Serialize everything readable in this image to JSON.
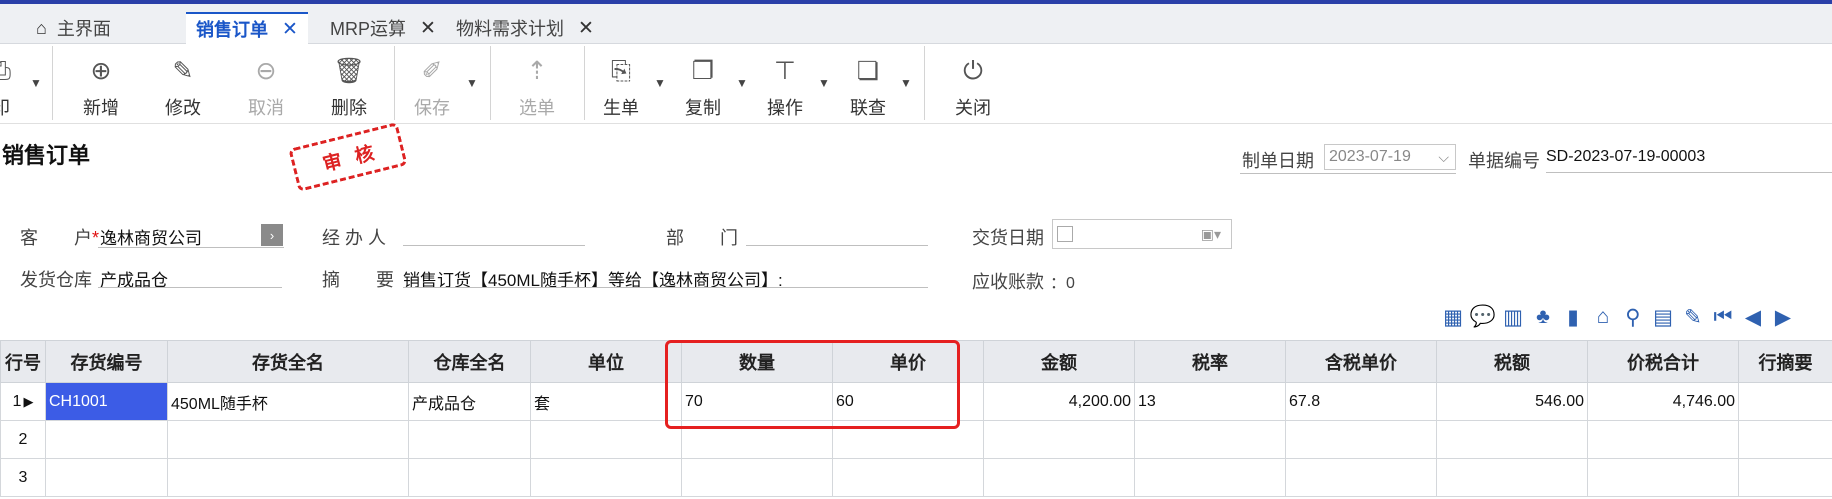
{
  "tabs": [
    {
      "label": "主界面",
      "icon": "home-icon"
    },
    {
      "label": "销售订单",
      "active": true
    },
    {
      "label": "MRP运算"
    },
    {
      "label": "物料需求计划"
    }
  ],
  "toolbar": {
    "print_label": "印",
    "new_label": "新增",
    "edit_label": "修改",
    "cancel_label": "取消",
    "delete_label": "删除",
    "save_label": "保存",
    "select_label": "选单",
    "generate_label": "生单",
    "copy_label": "复制",
    "operate_label": "操作",
    "linked_label": "联查",
    "close_label": "关闭"
  },
  "form": {
    "title": "销售订单",
    "stamp": "审核",
    "date_label": "制单日期",
    "date_value": "2023-07-19",
    "number_label": "单据编号",
    "number_value": "SD-2023-07-19-00003",
    "customer_label": "客　　户",
    "customer_value": "逸林商贸公司",
    "handler_label": "经 办 人",
    "handler_value": "",
    "dept_label": "部　　门",
    "dept_value": "",
    "delivery_date_label": "交货日期",
    "warehouse_label": "发货仓库",
    "warehouse_value": "产成品仓",
    "summary_label": "摘　　要",
    "summary_value": "销售订货【450ML随手杯】等给【逸林商贸公司】:",
    "receivable_label": "应收账款",
    "receivable_value": "：0"
  },
  "grid": {
    "headers": [
      "行号",
      "存货编号",
      "存货全名",
      "仓库全名",
      "单位",
      "数量",
      "单价",
      "金额",
      "税率",
      "含税单价",
      "税额",
      "价税合计",
      "行摘要"
    ],
    "rows": [
      {
        "num": "1",
        "code": "CH1001",
        "name": "450ML随手杯",
        "warehouse": "产成品仓",
        "unit": "套",
        "qty": "70",
        "price": "60",
        "amount": "4,200.00",
        "tax_rate": "13",
        "tax_price": "67.8",
        "tax": "546.00",
        "total": "4,746.00",
        "remark": ""
      },
      {
        "num": "2"
      },
      {
        "num": "3"
      }
    ]
  }
}
